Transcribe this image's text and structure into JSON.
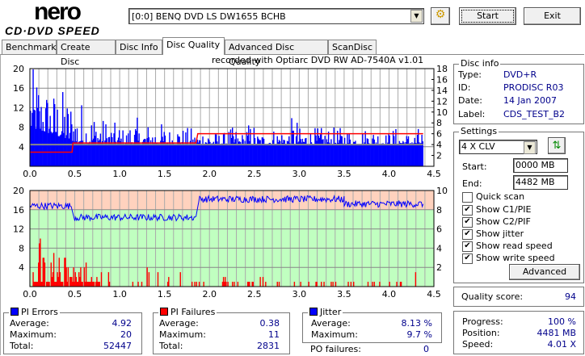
{
  "logo": {
    "line1": "nero",
    "line2": "CD·DVD SPEED"
  },
  "toolbar": {
    "drive": "[0:0]  BENQ DVD LS DW1655 BCHB",
    "start": "Start",
    "exit": "Exit"
  },
  "tabs": [
    "Benchmark",
    "Create Disc",
    "Disc Info",
    "Disc Quality",
    "Advanced Disc Quality",
    "ScanDisc"
  ],
  "recorded_with": "recorded with Optiarc  DVD  RW  AD-7540A   v1.01",
  "disc_info": {
    "title": "Disc info",
    "type_label": "Type:",
    "type": "DVD+R",
    "id_label": "ID:",
    "id": "PRODISC R03",
    "date_label": "Date:",
    "date": "14  Jan  2007",
    "label_label": "Label:",
    "label": "CDS_TEST_B2"
  },
  "settings": {
    "title": "Settings",
    "speed": "4 X CLV",
    "start_label": "Start:",
    "start": "0000 MB",
    "end_label": "End:",
    "end": "4482 MB",
    "checks": [
      {
        "label": "Quick scan",
        "checked": false
      },
      {
        "label": "Show C1/PIE",
        "checked": true
      },
      {
        "label": "Show C2/PIF",
        "checked": true
      },
      {
        "label": "Show jitter",
        "checked": true
      },
      {
        "label": "Show read speed",
        "checked": true
      },
      {
        "label": "Show write speed",
        "checked": true
      }
    ],
    "advanced": "Advanced"
  },
  "quality": {
    "label": "Quality score:",
    "value": "94"
  },
  "progress": {
    "progress_label": "Progress:",
    "progress": "100 %",
    "position_label": "Position:",
    "position": "4481 MB",
    "speed_label": "Speed:",
    "speed": "4.01 X"
  },
  "pi_errors": {
    "title": "PI Errors",
    "color": "#0000ff",
    "avg_label": "Average:",
    "avg": "4.92",
    "max_label": "Maximum:",
    "max": "20",
    "total_label": "Total:",
    "total": "52447"
  },
  "pi_failures": {
    "title": "PI Failures",
    "color": "#ff0000",
    "avg_label": "Average:",
    "avg": "0.38",
    "max_label": "Maximum:",
    "max": "11",
    "total_label": "Total:",
    "total": "2831"
  },
  "jitter": {
    "title": "Jitter",
    "color": "#0000ff",
    "avg_label": "Average:",
    "avg": "8.13 %",
    "max_label": "Maximum:",
    "max": "9.7 %",
    "po_label": "PO failures:",
    "po": "0"
  },
  "chart_data": [
    {
      "type": "bar",
      "title": "PI Errors / Read speed",
      "xlim": [
        0,
        4.5
      ],
      "xticks": [
        "0.0",
        "0.5",
        "1.0",
        "1.5",
        "2.0",
        "2.5",
        "3.0",
        "3.5",
        "4.0",
        "4.5"
      ],
      "ylim": [
        0,
        20
      ],
      "yticks": [
        "4",
        "8",
        "12",
        "16",
        "20"
      ],
      "y2lim": [
        0,
        18
      ],
      "y2ticks": [
        "2",
        "4",
        "6",
        "8",
        "10",
        "12",
        "14",
        "16",
        "18"
      ],
      "pie_max_per_0_1GB": [
        20,
        17,
        16,
        16,
        15,
        14,
        12,
        12,
        10,
        9,
        8,
        10,
        8,
        9,
        9,
        8,
        9,
        8,
        7,
        8,
        7,
        7,
        8,
        7,
        9,
        7,
        7,
        8,
        8,
        10,
        8,
        8,
        8,
        8,
        8,
        8,
        7,
        8,
        8,
        7,
        8,
        7,
        7,
        8
      ],
      "data_end": 4.38,
      "read_speed": [
        {
          "from": 0,
          "to": 0.47,
          "value": 2.6
        },
        {
          "from": 0.48,
          "to": 1.85,
          "value": 4.3
        },
        {
          "from": 1.87,
          "to": 4.38,
          "value": 6.0
        }
      ],
      "write_speed": 4.0
    },
    {
      "type": "bar",
      "title": "PI Failures / Jitter",
      "xlim": [
        0,
        4.5
      ],
      "xticks": [
        "0.0",
        "0.5",
        "1.0",
        "1.5",
        "2.0",
        "2.5",
        "3.0",
        "3.5",
        "4.0",
        "4.5"
      ],
      "ylim": [
        0,
        20
      ],
      "yticks": [
        "4",
        "8",
        "12",
        "16",
        "20"
      ],
      "y2lim": [
        0,
        10
      ],
      "y2ticks": [
        "2",
        "4",
        "6",
        "8",
        "10"
      ],
      "pif_max_per_0_1GB": [
        9,
        11,
        8,
        8,
        6,
        5,
        5,
        4,
        3,
        2,
        4,
        3,
        4,
        8,
        3,
        3,
        3,
        2,
        2,
        2,
        2,
        2,
        2,
        2,
        3,
        3,
        2,
        2,
        3,
        5,
        2,
        2,
        1,
        1,
        2,
        2,
        2,
        2,
        2,
        2,
        2,
        3,
        3,
        2
      ],
      "jitter": [
        {
          "from": 0,
          "to": 0.47,
          "value": 8.4
        },
        {
          "from": 0.5,
          "to": 1.86,
          "value": 7.2
        },
        {
          "from": 1.88,
          "to": 3.5,
          "value": 9.1
        },
        {
          "from": 3.5,
          "to": 4.38,
          "value": 8.6
        }
      ],
      "threshold": 8
    }
  ]
}
